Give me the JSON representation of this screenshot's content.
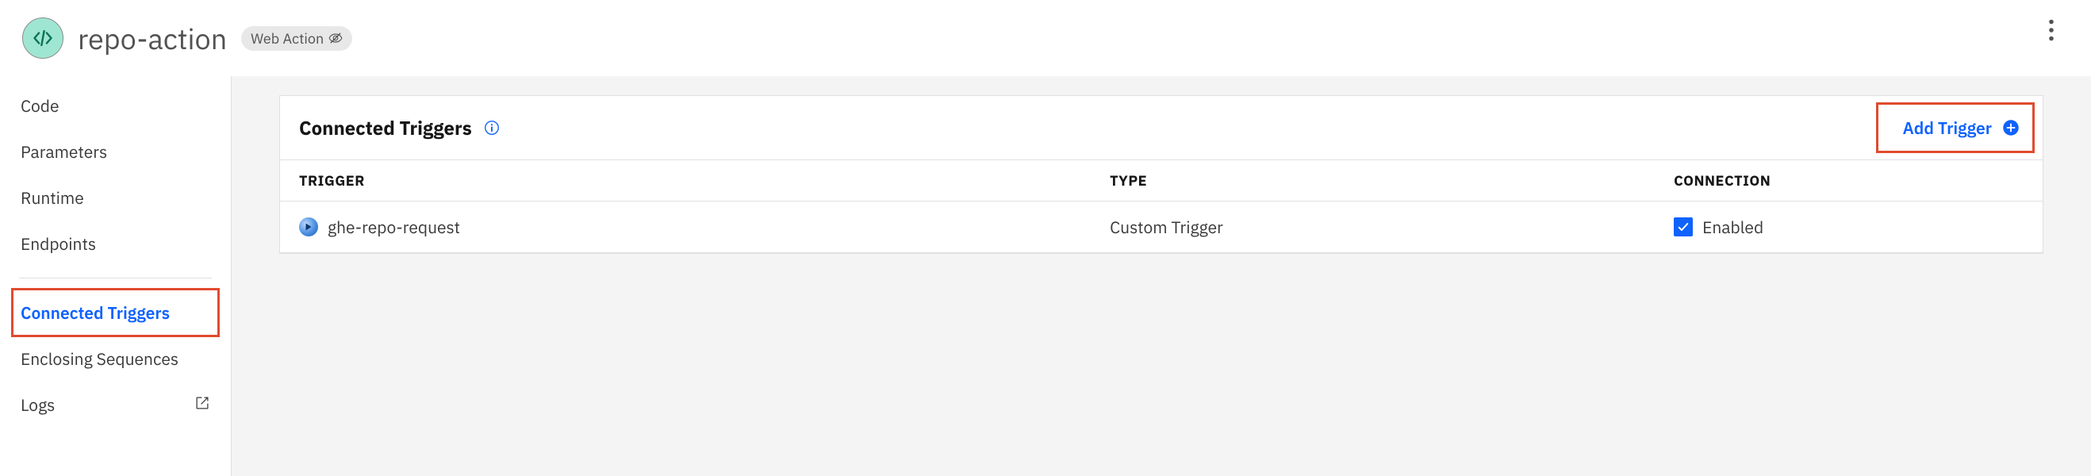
{
  "header": {
    "title": "repo-action",
    "chip_label": "Web Action"
  },
  "sidebar": {
    "group1": [
      {
        "label": "Code"
      },
      {
        "label": "Parameters"
      },
      {
        "label": "Runtime"
      },
      {
        "label": "Endpoints"
      }
    ],
    "group2": [
      {
        "label": "Connected Triggers",
        "selected": true
      },
      {
        "label": "Enclosing Sequences"
      },
      {
        "label": "Logs",
        "external": true
      }
    ]
  },
  "panel": {
    "title": "Connected Triggers",
    "add_button_label": "Add Trigger",
    "columns": {
      "trigger": "TRIGGER",
      "type": "TYPE",
      "connection": "CONNECTION"
    },
    "rows": [
      {
        "name": "ghe-repo-request",
        "type": "Custom Trigger",
        "connection_label": "Enabled",
        "connection_checked": true
      }
    ]
  }
}
